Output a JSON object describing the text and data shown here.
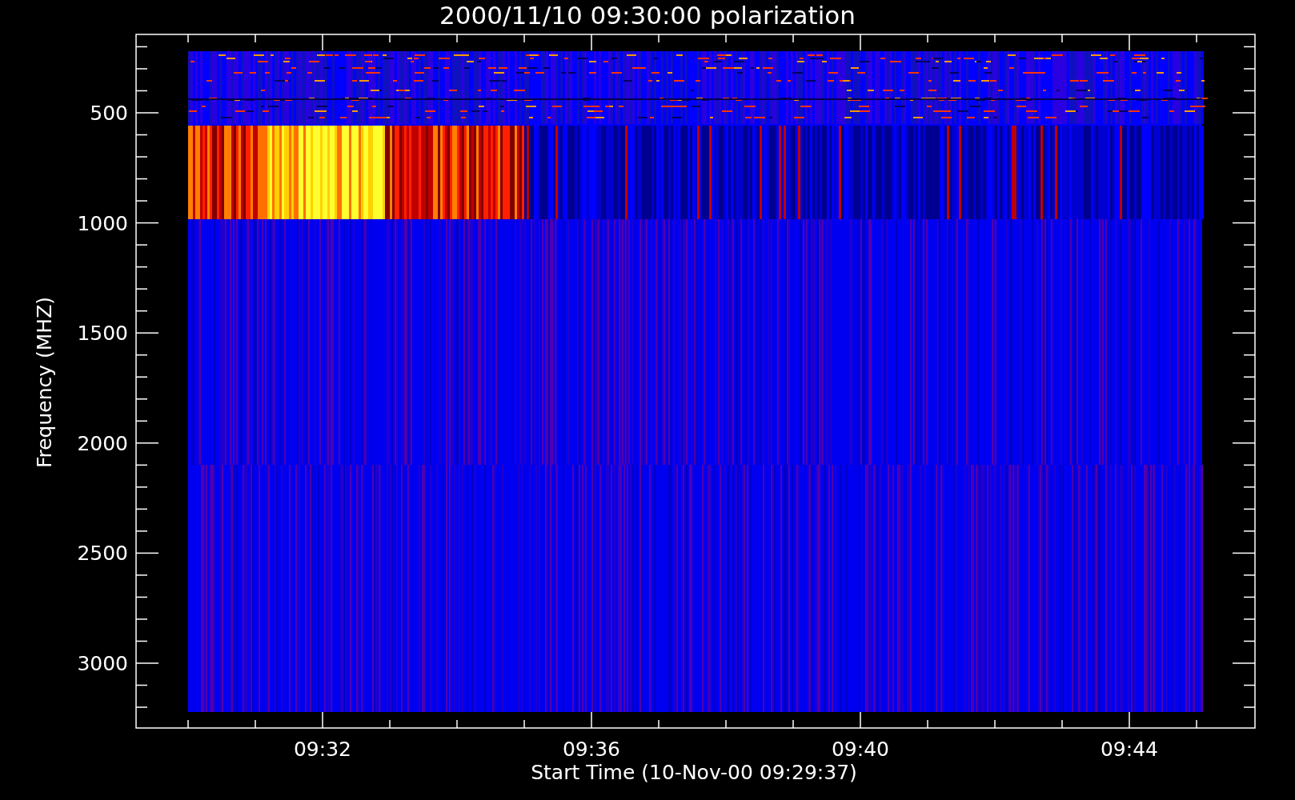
{
  "title": "2000/11/10 09:30:00 polarization",
  "y_axis": {
    "label": "Frequency (MHZ)",
    "ticks": [
      "500",
      "1000",
      "1500",
      "2000",
      "2500",
      "3000"
    ]
  },
  "x_axis": {
    "label": "Start Time (10-Nov-00 09:29:37)",
    "ticks": [
      "09:32",
      "09:36",
      "09:40",
      "09:44"
    ]
  }
}
